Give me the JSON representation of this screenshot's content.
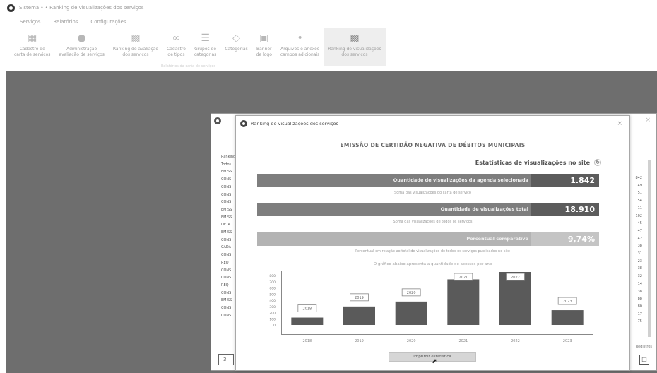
{
  "window": {
    "title": "Sistema • • Ranking de visualizações dos serviços"
  },
  "ribbon": {
    "tabs": [
      "Serviços",
      "Relatórios",
      "Configurações"
    ],
    "buttons": [
      {
        "label": "Cadastro de\ncarta de serviços",
        "icon": "grid-icon"
      },
      {
        "label": "Administração\navaliação de serviços",
        "icon": "user-icon"
      },
      {
        "label": "Ranking de avaliação\ndos serviços",
        "icon": "bar-chart-icon"
      },
      {
        "label": "Cadastro\nde tipos",
        "icon": "link-icon"
      },
      {
        "label": "Grupos de\ncategorias",
        "icon": "group-icon"
      },
      {
        "label": "Categorias",
        "icon": "tag-icon"
      },
      {
        "label": "Banner\nde logo",
        "icon": "image-icon"
      },
      {
        "label": "Arquivos e anexos\ncampos adicionais",
        "icon": "file-icon"
      },
      {
        "label": "Ranking de visualizações\ndos serviços",
        "icon": "ranking-chart-icon"
      }
    ],
    "group_label": "Relatórios da carta de serviços"
  },
  "background_window": {
    "header": "Ranking",
    "list_items": [
      "Todos",
      "EMISS",
      "CONS",
      "CONS",
      "CONS",
      "CONS",
      "EMISS",
      "EMISS",
      "DETA",
      "EMISS",
      "CONS",
      "CADA",
      "CONS",
      "REQ",
      "CONS",
      "CONS",
      "REQ",
      "CONS",
      "EMISS",
      "CONS",
      "CONS"
    ],
    "values": [
      "842",
      "49",
      "51",
      "54",
      "11",
      "102",
      "45",
      "47",
      "42",
      "38",
      "31",
      "23",
      "38",
      "32",
      "14",
      "38",
      "88",
      "80",
      "17",
      "75"
    ],
    "footer_label": "Registros",
    "left_button": "3",
    "right_button_icon": "export-icon"
  },
  "dialog": {
    "title": "Ranking de visualizações dos serviços",
    "heading": "EMISSÃO DE CERTIDÃO NEGATIVA DE DÉBITOS MUNICIPAIS",
    "stats_label": "Estatísticas de visualizações no site",
    "metrics": [
      {
        "label": "Quantidade de visualizações da agenda selecionada",
        "value": "1.842",
        "note": "Soma das visualizações do carta de serviço"
      },
      {
        "label": "Quantidade de visualizações total",
        "value": "18.910",
        "note": "Soma das visualizações de todos os serviços"
      },
      {
        "label": "Percentual comparativo",
        "value": "9,74%",
        "note": "Percentual em relação ao total de visualizações de todos os serviços publicados no site"
      }
    ],
    "chart_caption": "O gráfico abaixo apresenta a quantidade de acessos por ano",
    "show_button": "Imprimir estatística"
  },
  "chart_data": {
    "type": "bar",
    "categories": [
      "2018",
      "2019",
      "2020",
      "2021",
      "2022",
      "2023"
    ],
    "values": [
      120,
      300,
      380,
      740,
      860,
      240
    ],
    "data_labels": [
      "2018",
      "2019",
      "2020",
      "2021",
      "2022",
      "2023"
    ],
    "yticks": [
      0,
      100,
      200,
      300,
      400,
      500,
      600,
      700,
      800
    ],
    "ylim": [
      0,
      860
    ],
    "xlabel": "",
    "ylabel": "",
    "grid": false,
    "colors": {
      "bar": "#5a5a5a",
      "label_box": "#ffffff"
    }
  }
}
